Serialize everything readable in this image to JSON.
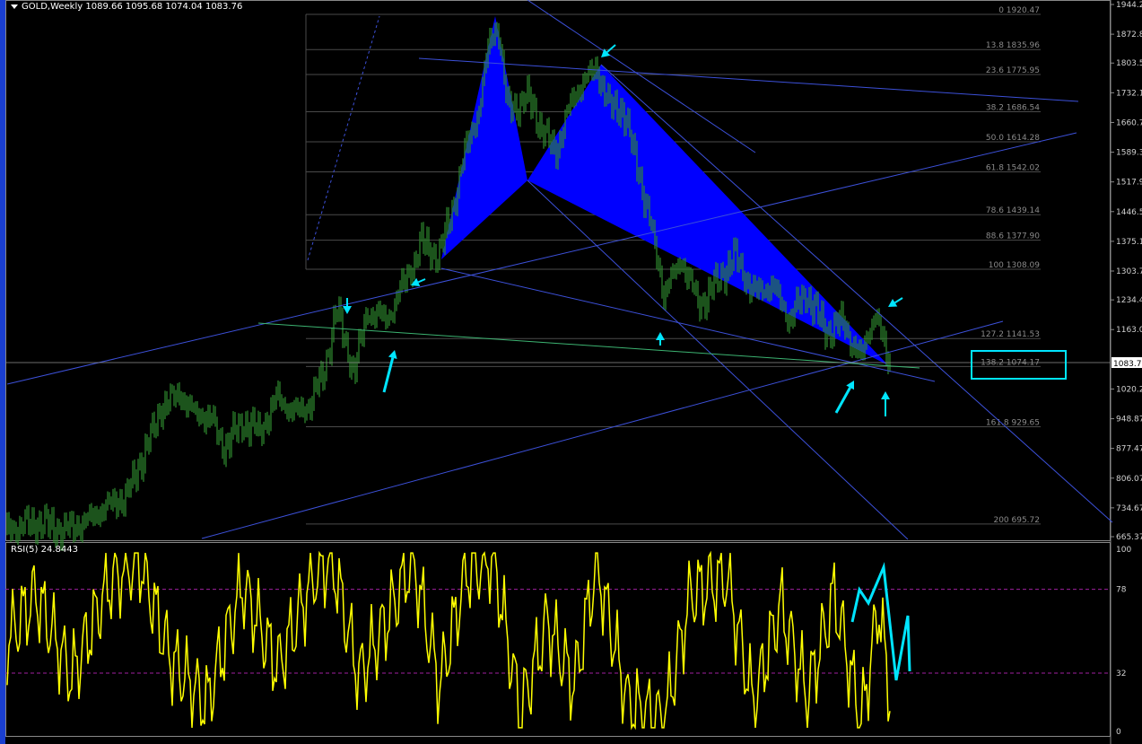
{
  "header": {
    "symbol": "GOLD,Weekly",
    "ohlc": "1089.66 1095.68 1074.04 1083.76"
  },
  "price_scale": {
    "labels": [
      "1944.2",
      "1872.8",
      "1803.5",
      "1732.1",
      "1660.7",
      "1589.3",
      "1517.9",
      "1446.5",
      "1375.1",
      "1303.7",
      "1234.4",
      "1163.0",
      "1020.2",
      "948.87",
      "877.47",
      "806.07",
      "734.67",
      "665.37"
    ],
    "current_price_label": "1083.7"
  },
  "fib_levels": [
    {
      "label": "0 1920.47",
      "price": 1920.47
    },
    {
      "label": "13.8 1835.96",
      "price": 1835.96
    },
    {
      "label": "23.6 1775.95",
      "price": 1775.95
    },
    {
      "label": "38.2 1686.54",
      "price": 1686.54
    },
    {
      "label": "50.0 1614.28",
      "price": 1614.28
    },
    {
      "label": "61.8 1542.02",
      "price": 1542.02
    },
    {
      "label": "78.6 1439.14",
      "price": 1439.14
    },
    {
      "label": "88.6 1377.90",
      "price": 1377.9
    },
    {
      "label": "100 1308.09",
      "price": 1308.09
    },
    {
      "label": "127.2 1141.53",
      "price": 1141.53
    },
    {
      "label": "138.2 1074.17",
      "price": 1074.17
    },
    {
      "label": "161.8 929.65",
      "price": 929.65
    },
    {
      "label": "200 695.72",
      "price": 695.72
    }
  ],
  "rsi": {
    "header": "RSI(5) 24.8443",
    "scale_labels": [
      "100",
      "78",
      "32",
      "0"
    ],
    "levels": [
      78,
      32
    ]
  },
  "colors": {
    "background": "#000000",
    "candles": "#2e8b2e",
    "pattern_fill": "#0000ff",
    "trendline": "#3c50d8",
    "fib_line": "#4a4a4a",
    "fib_text": "#8a8a8a",
    "annotation": "#00e5ff",
    "rsi_line": "#ffff00",
    "rsi_level": "#a020a0",
    "frame": "#888888"
  },
  "chart_data": {
    "type": "line",
    "title": "GOLD,Weekly",
    "ylim": [
      665.37,
      1944.2
    ],
    "series": [
      {
        "name": "GOLD,Weekly",
        "x": [
          1,
          20,
          45,
          70,
          95,
          120,
          140,
          160,
          180,
          200,
          215,
          235,
          250,
          270,
          290,
          310,
          330,
          345,
          360,
          375,
          395,
          410,
          430,
          450,
          470,
          490,
          505,
          520,
          535,
          545,
          555,
          565,
          575,
          590,
          605,
          620,
          635,
          650,
          665,
          680,
          695,
          710,
          725,
          740,
          760,
          780,
          800,
          820,
          840,
          860,
          880,
          900,
          920,
          940,
          960,
          975,
          990
        ],
        "values": [
          680,
          690,
          700,
          680,
          700,
          740,
          760,
          860,
          975,
          1010,
          965,
          950,
          880,
          940,
          920,
          1000,
          960,
          985,
          1050,
          1210,
          1060,
          1210,
          1185,
          1270,
          1370,
          1340,
          1460,
          1600,
          1700,
          1850,
          1900,
          1700,
          1700,
          1720,
          1640,
          1590,
          1700,
          1760,
          1790,
          1700,
          1690,
          1560,
          1420,
          1250,
          1330,
          1220,
          1280,
          1340,
          1250,
          1270,
          1190,
          1250,
          1160,
          1180,
          1090,
          1210,
          1084
        ]
      },
      {
        "name": "RSI(5)",
        "x": [
          1,
          40,
          80,
          120,
          155,
          190,
          230,
          270,
          310,
          350,
          370,
          400,
          430,
          460,
          490,
          520,
          550,
          580,
          610,
          640,
          665,
          700,
          740,
          770,
          810,
          840,
          870,
          900,
          930,
          960,
          980,
          990
        ],
        "values": [
          45,
          75,
          30,
          80,
          95,
          40,
          15,
          80,
          35,
          85,
          95,
          30,
          60,
          95,
          25,
          88,
          95,
          10,
          60,
          25,
          92,
          15,
          5,
          75,
          85,
          15,
          70,
          20,
          75,
          5,
          70,
          25
        ]
      }
    ],
    "legend": "top-left"
  }
}
